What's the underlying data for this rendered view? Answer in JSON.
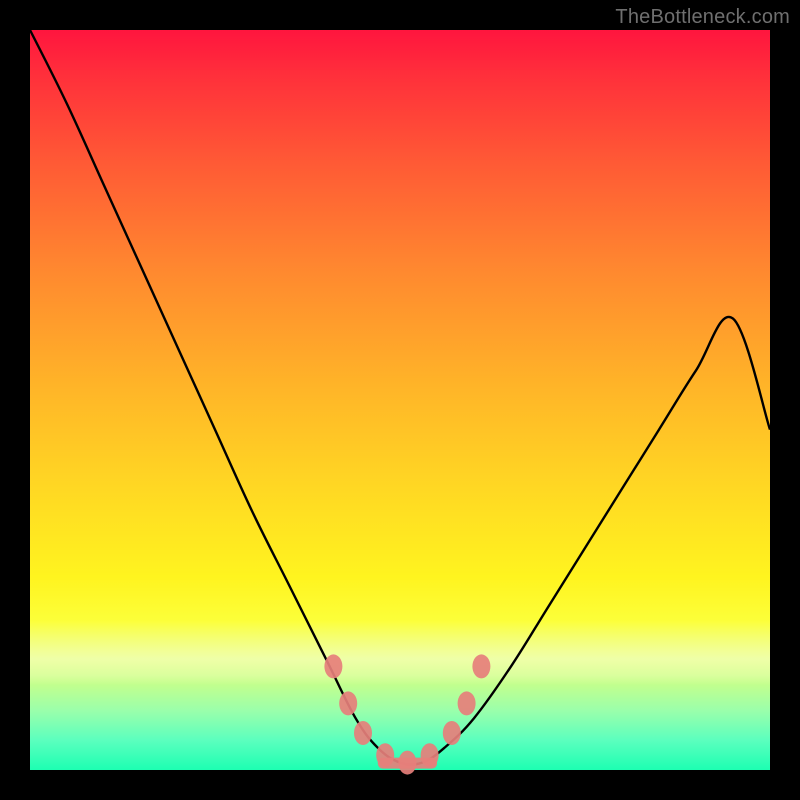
{
  "watermark": "TheBottleneck.com",
  "chart_data": {
    "type": "line",
    "title": "",
    "xlabel": "",
    "ylabel": "",
    "xlim": [
      0,
      100
    ],
    "ylim": [
      0,
      100
    ],
    "legend": false,
    "grid": false,
    "background": {
      "gradient": "vertical",
      "stops": [
        {
          "pos": 0,
          "color": "#ff153e"
        },
        {
          "pos": 50,
          "color": "#ffb428"
        },
        {
          "pos": 80,
          "color": "#fcff3a"
        },
        {
          "pos": 100,
          "color": "#1dffb2"
        }
      ]
    },
    "series": [
      {
        "name": "bottleneck-curve",
        "color": "#000000",
        "x": [
          0,
          5,
          10,
          15,
          20,
          25,
          30,
          35,
          40,
          44,
          47,
          50,
          53,
          56,
          60,
          65,
          70,
          75,
          80,
          85,
          90,
          95,
          100
        ],
        "y": [
          100,
          90,
          79,
          68,
          57,
          46,
          35,
          25,
          15,
          7,
          3,
          1,
          1,
          3,
          7,
          14,
          22,
          30,
          38,
          46,
          54,
          61,
          46
        ]
      }
    ],
    "markers": [
      {
        "name": "valley-left-upper",
        "x": 41,
        "y": 14,
        "color": "#e67f7b"
      },
      {
        "name": "valley-left-mid",
        "x": 43,
        "y": 9,
        "color": "#e67f7b"
      },
      {
        "name": "valley-left-lower",
        "x": 45,
        "y": 5,
        "color": "#e67f7b"
      },
      {
        "name": "valley-bottom-1",
        "x": 48,
        "y": 2,
        "color": "#e67f7b"
      },
      {
        "name": "valley-bottom-2",
        "x": 51,
        "y": 1,
        "color": "#e67f7b"
      },
      {
        "name": "valley-bottom-3",
        "x": 54,
        "y": 2,
        "color": "#e67f7b"
      },
      {
        "name": "valley-right-lower",
        "x": 57,
        "y": 5,
        "color": "#e67f7b"
      },
      {
        "name": "valley-right-mid",
        "x": 59,
        "y": 9,
        "color": "#e67f7b"
      },
      {
        "name": "valley-right-upper",
        "x": 61,
        "y": 14,
        "color": "#e67f7b"
      }
    ]
  }
}
